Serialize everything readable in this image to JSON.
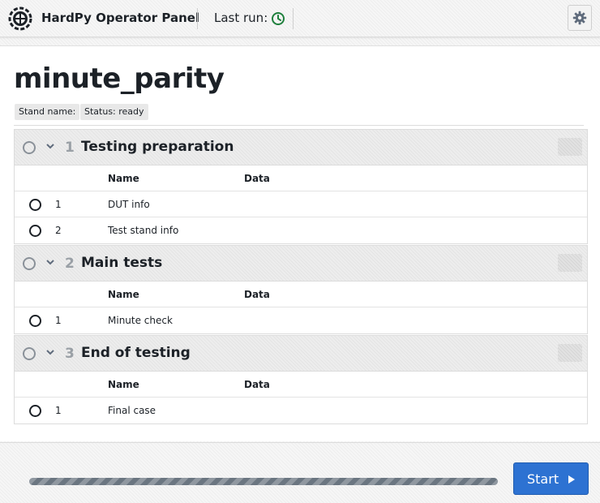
{
  "header": {
    "app_title": "HardPy Operator Panel",
    "last_run_label": "Last run:",
    "icons": {
      "logo": "hardpy-gear-logo-icon",
      "last_run": "clock-icon",
      "settings": "gear-icon"
    },
    "last_run_color": "#1e7f3c"
  },
  "main": {
    "title": "minute_parity",
    "tags": [
      "Stand name:",
      "Status: ready"
    ],
    "column_headers": {
      "name": "Name",
      "data": "Data"
    },
    "sections": [
      {
        "number": "1",
        "name": "Testing preparation",
        "cases": [
          {
            "number": "1",
            "name": "DUT info"
          },
          {
            "number": "2",
            "name": "Test stand info"
          }
        ]
      },
      {
        "number": "2",
        "name": "Main tests",
        "cases": [
          {
            "number": "1",
            "name": "Minute check"
          }
        ]
      },
      {
        "number": "3",
        "name": "End of testing",
        "cases": [
          {
            "number": "1",
            "name": "Final case"
          }
        ]
      }
    ]
  },
  "footer": {
    "progress": 1.0,
    "start_label": "Start",
    "start_icon": "play-icon",
    "accent_color": "#2d72d2"
  }
}
